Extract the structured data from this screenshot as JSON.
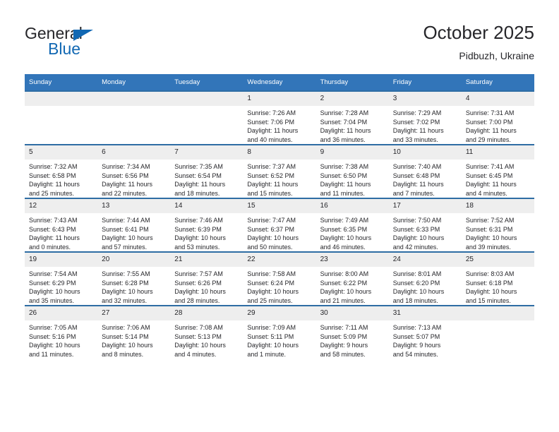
{
  "brand": {
    "name_part1": "General",
    "name_part2": "Blue",
    "triangle_color": "#1268b3"
  },
  "header": {
    "title": "October 2025",
    "subtitle": "Pidbuzh, Ukraine"
  },
  "theme": {
    "header_bg": "#3275b9",
    "row_border": "#2e6da4",
    "daynum_bg": "#eeeeee",
    "text": "#26262a"
  },
  "weekdays": [
    "Sunday",
    "Monday",
    "Tuesday",
    "Wednesday",
    "Thursday",
    "Friday",
    "Saturday"
  ],
  "weeks": [
    [
      {
        "day": "",
        "l1": "",
        "l2": "",
        "l3": "",
        "l4": ""
      },
      {
        "day": "",
        "l1": "",
        "l2": "",
        "l3": "",
        "l4": ""
      },
      {
        "day": "",
        "l1": "",
        "l2": "",
        "l3": "",
        "l4": ""
      },
      {
        "day": "1",
        "l1": "Sunrise: 7:26 AM",
        "l2": "Sunset: 7:06 PM",
        "l3": "Daylight: 11 hours",
        "l4": "and 40 minutes."
      },
      {
        "day": "2",
        "l1": "Sunrise: 7:28 AM",
        "l2": "Sunset: 7:04 PM",
        "l3": "Daylight: 11 hours",
        "l4": "and 36 minutes."
      },
      {
        "day": "3",
        "l1": "Sunrise: 7:29 AM",
        "l2": "Sunset: 7:02 PM",
        "l3": "Daylight: 11 hours",
        "l4": "and 33 minutes."
      },
      {
        "day": "4",
        "l1": "Sunrise: 7:31 AM",
        "l2": "Sunset: 7:00 PM",
        "l3": "Daylight: 11 hours",
        "l4": "and 29 minutes."
      }
    ],
    [
      {
        "day": "5",
        "l1": "Sunrise: 7:32 AM",
        "l2": "Sunset: 6:58 PM",
        "l3": "Daylight: 11 hours",
        "l4": "and 25 minutes."
      },
      {
        "day": "6",
        "l1": "Sunrise: 7:34 AM",
        "l2": "Sunset: 6:56 PM",
        "l3": "Daylight: 11 hours",
        "l4": "and 22 minutes."
      },
      {
        "day": "7",
        "l1": "Sunrise: 7:35 AM",
        "l2": "Sunset: 6:54 PM",
        "l3": "Daylight: 11 hours",
        "l4": "and 18 minutes."
      },
      {
        "day": "8",
        "l1": "Sunrise: 7:37 AM",
        "l2": "Sunset: 6:52 PM",
        "l3": "Daylight: 11 hours",
        "l4": "and 15 minutes."
      },
      {
        "day": "9",
        "l1": "Sunrise: 7:38 AM",
        "l2": "Sunset: 6:50 PM",
        "l3": "Daylight: 11 hours",
        "l4": "and 11 minutes."
      },
      {
        "day": "10",
        "l1": "Sunrise: 7:40 AM",
        "l2": "Sunset: 6:48 PM",
        "l3": "Daylight: 11 hours",
        "l4": "and 7 minutes."
      },
      {
        "day": "11",
        "l1": "Sunrise: 7:41 AM",
        "l2": "Sunset: 6:45 PM",
        "l3": "Daylight: 11 hours",
        "l4": "and 4 minutes."
      }
    ],
    [
      {
        "day": "12",
        "l1": "Sunrise: 7:43 AM",
        "l2": "Sunset: 6:43 PM",
        "l3": "Daylight: 11 hours",
        "l4": "and 0 minutes."
      },
      {
        "day": "13",
        "l1": "Sunrise: 7:44 AM",
        "l2": "Sunset: 6:41 PM",
        "l3": "Daylight: 10 hours",
        "l4": "and 57 minutes."
      },
      {
        "day": "14",
        "l1": "Sunrise: 7:46 AM",
        "l2": "Sunset: 6:39 PM",
        "l3": "Daylight: 10 hours",
        "l4": "and 53 minutes."
      },
      {
        "day": "15",
        "l1": "Sunrise: 7:47 AM",
        "l2": "Sunset: 6:37 PM",
        "l3": "Daylight: 10 hours",
        "l4": "and 50 minutes."
      },
      {
        "day": "16",
        "l1": "Sunrise: 7:49 AM",
        "l2": "Sunset: 6:35 PM",
        "l3": "Daylight: 10 hours",
        "l4": "and 46 minutes."
      },
      {
        "day": "17",
        "l1": "Sunrise: 7:50 AM",
        "l2": "Sunset: 6:33 PM",
        "l3": "Daylight: 10 hours",
        "l4": "and 42 minutes."
      },
      {
        "day": "18",
        "l1": "Sunrise: 7:52 AM",
        "l2": "Sunset: 6:31 PM",
        "l3": "Daylight: 10 hours",
        "l4": "and 39 minutes."
      }
    ],
    [
      {
        "day": "19",
        "l1": "Sunrise: 7:54 AM",
        "l2": "Sunset: 6:29 PM",
        "l3": "Daylight: 10 hours",
        "l4": "and 35 minutes."
      },
      {
        "day": "20",
        "l1": "Sunrise: 7:55 AM",
        "l2": "Sunset: 6:28 PM",
        "l3": "Daylight: 10 hours",
        "l4": "and 32 minutes."
      },
      {
        "day": "21",
        "l1": "Sunrise: 7:57 AM",
        "l2": "Sunset: 6:26 PM",
        "l3": "Daylight: 10 hours",
        "l4": "and 28 minutes."
      },
      {
        "day": "22",
        "l1": "Sunrise: 7:58 AM",
        "l2": "Sunset: 6:24 PM",
        "l3": "Daylight: 10 hours",
        "l4": "and 25 minutes."
      },
      {
        "day": "23",
        "l1": "Sunrise: 8:00 AM",
        "l2": "Sunset: 6:22 PM",
        "l3": "Daylight: 10 hours",
        "l4": "and 21 minutes."
      },
      {
        "day": "24",
        "l1": "Sunrise: 8:01 AM",
        "l2": "Sunset: 6:20 PM",
        "l3": "Daylight: 10 hours",
        "l4": "and 18 minutes."
      },
      {
        "day": "25",
        "l1": "Sunrise: 8:03 AM",
        "l2": "Sunset: 6:18 PM",
        "l3": "Daylight: 10 hours",
        "l4": "and 15 minutes."
      }
    ],
    [
      {
        "day": "26",
        "l1": "Sunrise: 7:05 AM",
        "l2": "Sunset: 5:16 PM",
        "l3": "Daylight: 10 hours",
        "l4": "and 11 minutes."
      },
      {
        "day": "27",
        "l1": "Sunrise: 7:06 AM",
        "l2": "Sunset: 5:14 PM",
        "l3": "Daylight: 10 hours",
        "l4": "and 8 minutes."
      },
      {
        "day": "28",
        "l1": "Sunrise: 7:08 AM",
        "l2": "Sunset: 5:13 PM",
        "l3": "Daylight: 10 hours",
        "l4": "and 4 minutes."
      },
      {
        "day": "29",
        "l1": "Sunrise: 7:09 AM",
        "l2": "Sunset: 5:11 PM",
        "l3": "Daylight: 10 hours",
        "l4": "and 1 minute."
      },
      {
        "day": "30",
        "l1": "Sunrise: 7:11 AM",
        "l2": "Sunset: 5:09 PM",
        "l3": "Daylight: 9 hours",
        "l4": "and 58 minutes."
      },
      {
        "day": "31",
        "l1": "Sunrise: 7:13 AM",
        "l2": "Sunset: 5:07 PM",
        "l3": "Daylight: 9 hours",
        "l4": "and 54 minutes."
      },
      {
        "day": "",
        "l1": "",
        "l2": "",
        "l3": "",
        "l4": ""
      }
    ]
  ]
}
